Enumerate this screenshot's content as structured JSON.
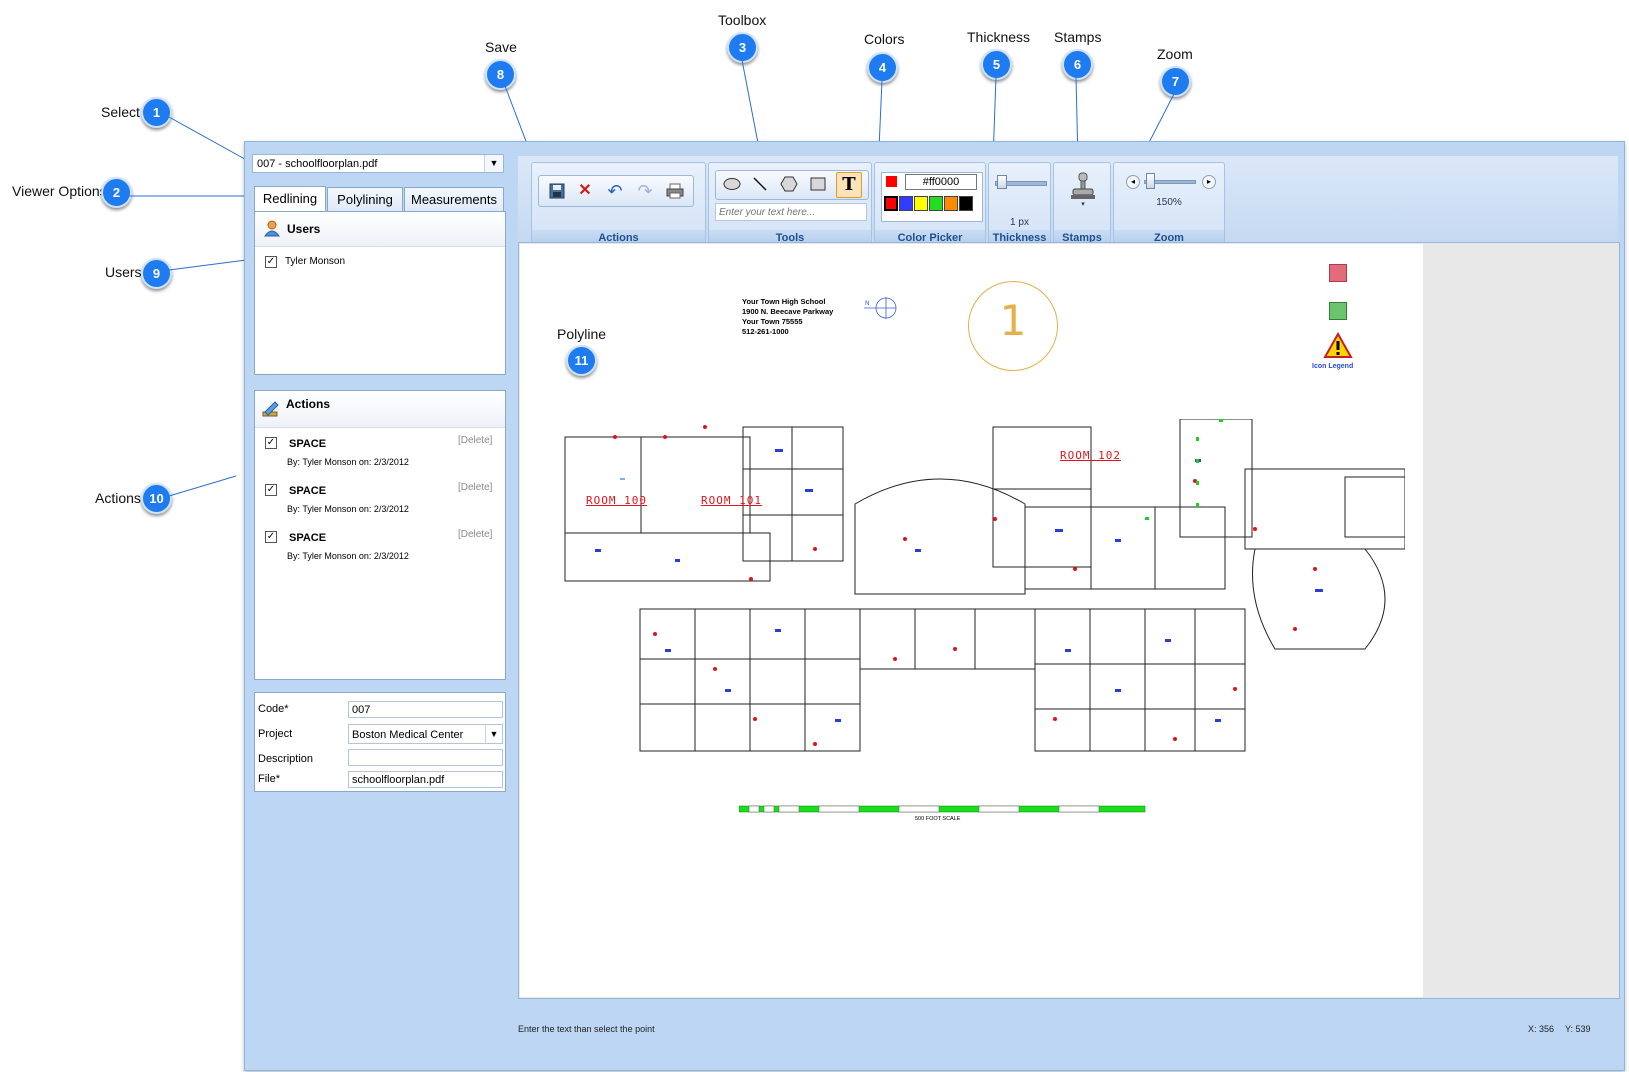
{
  "callouts": {
    "select": {
      "label": "Select",
      "number": "1"
    },
    "viewer_options": {
      "label": "Viewer Options",
      "number": "2"
    },
    "toolbox": {
      "label": "Toolbox",
      "number": "3"
    },
    "colors": {
      "label": "Colors",
      "number": "4"
    },
    "thickness": {
      "label": "Thickness",
      "number": "5"
    },
    "stamps": {
      "label": "Stamps",
      "number": "6"
    },
    "zoom": {
      "label": "Zoom",
      "number": "7"
    },
    "save": {
      "label": "Save",
      "number": "8"
    },
    "users": {
      "label": "Users",
      "number": "9"
    },
    "actions": {
      "label": "Actions",
      "number": "10"
    },
    "polyline": {
      "label": "Polyline",
      "number": "11"
    }
  },
  "file_select": {
    "value": "007 - schoolfloorplan.pdf"
  },
  "tabs": [
    {
      "label": "Redlining",
      "active": true
    },
    {
      "label": "Polylining",
      "active": false
    },
    {
      "label": "Measurements",
      "active": false
    }
  ],
  "users_panel": {
    "title": "Users",
    "items": [
      {
        "name": "Tyler Monson",
        "checked": true
      }
    ]
  },
  "actions_panel": {
    "title": "Actions",
    "items": [
      {
        "name": "SPACE",
        "by": "By: Tyler Monson on: 2/3/2012",
        "delete_label": "[Delete]",
        "checked": true
      },
      {
        "name": "SPACE",
        "by": "By: Tyler Monson on: 2/3/2012",
        "delete_label": "[Delete]",
        "checked": true
      },
      {
        "name": "SPACE",
        "by": "By: Tyler Monson on: 2/3/2012",
        "delete_label": "[Delete]",
        "checked": true
      }
    ]
  },
  "form": {
    "code": {
      "label": "Code*",
      "value": "007"
    },
    "project": {
      "label": "Project",
      "value": "Boston Medical Center"
    },
    "description": {
      "label": "Description",
      "value": ""
    },
    "file": {
      "label": "File*",
      "value": "schoolfloorplan.pdf"
    }
  },
  "toolbar": {
    "actions_label": "Actions",
    "tools_label": "Tools",
    "text_placeholder": "Enter your text here...",
    "color_picker_label": "Color Picker",
    "color_value": "#ff0000",
    "palette": [
      "#ff0000",
      "#2f3cff",
      "#ffff00",
      "#22dd22",
      "#ff8c00",
      "#000000"
    ],
    "thickness_label": "Thickness",
    "thickness_value": "1 px",
    "thickness_level": 0.05,
    "stamps_label": "Stamps",
    "zoom_label": "Zoom",
    "zoom_value": "150%",
    "zoom_level": 0.05,
    "icons": [
      "save-icon",
      "delete-icon",
      "undo-icon",
      "redo-icon",
      "print-icon",
      "ellipse-icon",
      "line-icon",
      "polygon-icon",
      "rectangle-icon",
      "text-icon",
      "stamp-icon"
    ]
  },
  "document": {
    "address": [
      "Your Town High School",
      "1900 N. Beecave Parkway",
      "Your Town 75555",
      "512-261-1000"
    ],
    "big_number": "1",
    "icon_legend": "Icon Legend",
    "rooms": [
      "ROOM 100",
      "ROOM 101",
      "ROOM 102"
    ],
    "scale_label": "500 FOOT SCALE"
  },
  "status_bar": {
    "message": "Enter the text than select the point",
    "x": "X: 356",
    "y": "Y: 539"
  }
}
